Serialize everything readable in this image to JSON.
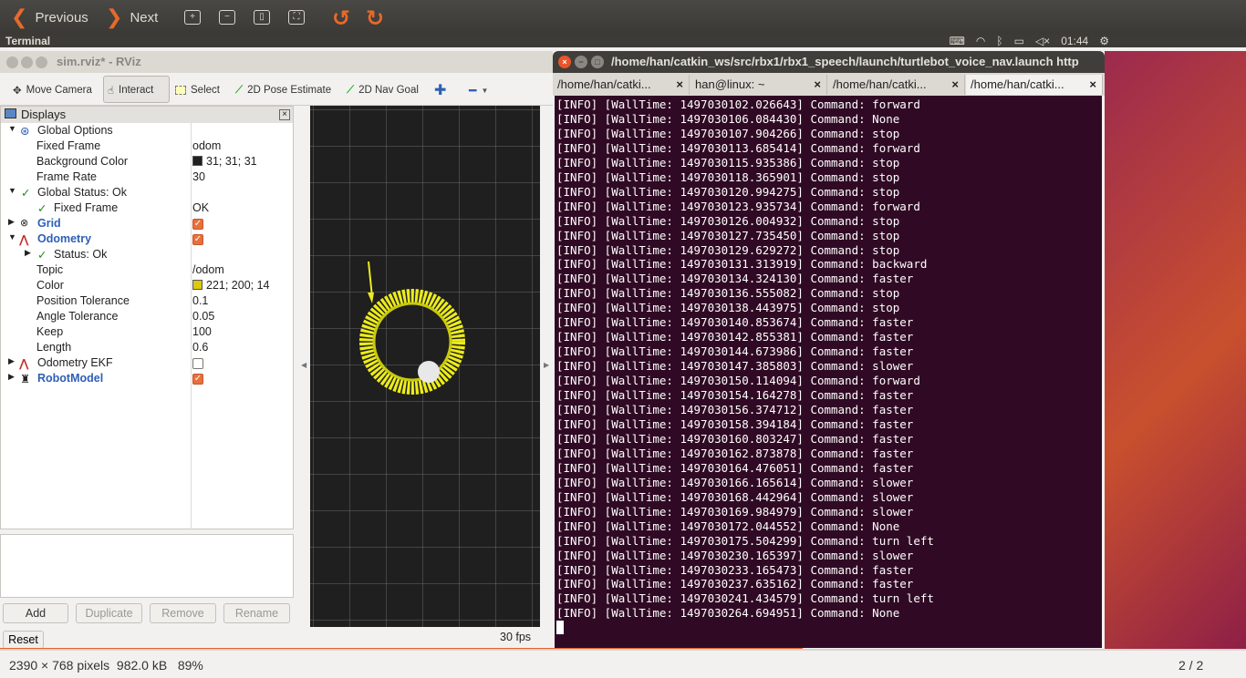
{
  "viewer": {
    "previous_label": "Previous",
    "next_label": "Next",
    "tool_icons": [
      "zoom-in-icon",
      "zoom-out-icon",
      "fit-page-icon",
      "fit-width-icon"
    ],
    "rotate_icons": [
      "rotate-left-icon",
      "rotate-right-icon"
    ],
    "status_info": "2390 × 768 pixels  982.0 kB   89%",
    "page_counter": "2 / 2"
  },
  "topbar": {
    "app_name": "Terminal",
    "clock": "01:44"
  },
  "rviz": {
    "title": "sim.rviz* - RViz",
    "tools": [
      "Move Camera",
      "Interact",
      "Select",
      "2D Pose Estimate",
      "2D Nav Goal"
    ],
    "displays_title": "Displays",
    "tree": [
      {
        "label": "Global Options",
        "value": ""
      },
      {
        "label": "Fixed Frame",
        "value": "odom"
      },
      {
        "label": "Background Color",
        "value": "31; 31; 31"
      },
      {
        "label": "Frame Rate",
        "value": "30"
      },
      {
        "label": "Global Status: Ok",
        "value": ""
      },
      {
        "label": "Fixed Frame",
        "value": "OK"
      },
      {
        "label": "Grid",
        "value": ""
      },
      {
        "label": "Odometry",
        "value": ""
      },
      {
        "label": "Status: Ok",
        "value": ""
      },
      {
        "label": "Topic",
        "value": "/odom"
      },
      {
        "label": "Color",
        "value": "221; 200; 14"
      },
      {
        "label": "Position Tolerance",
        "value": "0.1"
      },
      {
        "label": "Angle Tolerance",
        "value": "0.05"
      },
      {
        "label": "Keep",
        "value": "100"
      },
      {
        "label": "Length",
        "value": "0.6"
      },
      {
        "label": "Odometry EKF",
        "value": ""
      },
      {
        "label": "RobotModel",
        "value": ""
      }
    ],
    "buttons": {
      "add": "Add",
      "duplicate": "Duplicate",
      "remove": "Remove",
      "rename": "Rename",
      "reset": "Reset"
    },
    "fps": "30 fps",
    "colors": {
      "background": "#1f1f1f",
      "odometry": "#ddc80e"
    }
  },
  "terminal": {
    "title": "/home/han/catkin_ws/src/rbx1/rbx1_speech/launch/turtlebot_voice_nav.launch http",
    "tabs": [
      "/home/han/catki...",
      "han@linux: ~",
      "/home/han/catki...",
      "/home/han/catki..."
    ],
    "lines": [
      "[INFO] [WallTime: 1497030102.026643] Command: forward",
      "[INFO] [WallTime: 1497030106.084430] Command: None",
      "[INFO] [WallTime: 1497030107.904266] Command: stop",
      "[INFO] [WallTime: 1497030113.685414] Command: forward",
      "[INFO] [WallTime: 1497030115.935386] Command: stop",
      "[INFO] [WallTime: 1497030118.365901] Command: stop",
      "[INFO] [WallTime: 1497030120.994275] Command: stop",
      "[INFO] [WallTime: 1497030123.935734] Command: forward",
      "[INFO] [WallTime: 1497030126.004932] Command: stop",
      "[INFO] [WallTime: 1497030127.735450] Command: stop",
      "[INFO] [WallTime: 1497030129.629272] Command: stop",
      "[INFO] [WallTime: 1497030131.313919] Command: backward",
      "[INFO] [WallTime: 1497030134.324130] Command: faster",
      "[INFO] [WallTime: 1497030136.555082] Command: stop",
      "[INFO] [WallTime: 1497030138.443975] Command: stop",
      "[INFO] [WallTime: 1497030140.853674] Command: faster",
      "[INFO] [WallTime: 1497030142.855381] Command: faster",
      "[INFO] [WallTime: 1497030144.673986] Command: faster",
      "[INFO] [WallTime: 1497030147.385803] Command: slower",
      "[INFO] [WallTime: 1497030150.114094] Command: forward",
      "[INFO] [WallTime: 1497030154.164278] Command: faster",
      "[INFO] [WallTime: 1497030156.374712] Command: faster",
      "[INFO] [WallTime: 1497030158.394184] Command: faster",
      "[INFO] [WallTime: 1497030160.803247] Command: faster",
      "[INFO] [WallTime: 1497030162.873878] Command: faster",
      "[INFO] [WallTime: 1497030164.476051] Command: faster",
      "[INFO] [WallTime: 1497030166.165614] Command: slower",
      "[INFO] [WallTime: 1497030168.442964] Command: slower",
      "[INFO] [WallTime: 1497030169.984979] Command: slower",
      "[INFO] [WallTime: 1497030172.044552] Command: None",
      "[INFO] [WallTime: 1497030175.504299] Command: turn left",
      "[INFO] [WallTime: 1497030230.165397] Command: slower",
      "[INFO] [WallTime: 1497030233.165473] Command: faster",
      "[INFO] [WallTime: 1497030237.635162] Command: faster",
      "[INFO] [WallTime: 1497030241.434579] Command: turn left",
      "[INFO] [WallTime: 1497030264.694951] Command: None"
    ],
    "colors": {
      "background": "#300a24",
      "text": "#ffffff"
    }
  }
}
